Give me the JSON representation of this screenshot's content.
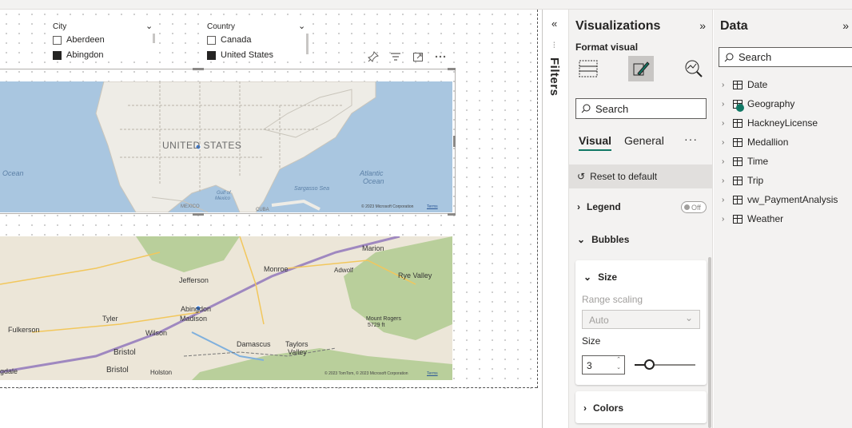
{
  "canvas": {
    "city_slicer": {
      "header": "City",
      "items": [
        {
          "label": "Aberdeen",
          "checked": false
        },
        {
          "label": "Abingdon",
          "checked": true
        }
      ]
    },
    "country_slicer": {
      "header": "Country",
      "items": [
        {
          "label": "Canada",
          "checked": false
        },
        {
          "label": "United States",
          "checked": true
        }
      ]
    },
    "map_top": {
      "country_label": "UNITED STATES",
      "ocean_left": "Ocean",
      "ocean_right_1": "Atlantic",
      "ocean_right_2": "Ocean",
      "sargasso": "Sargasso Sea",
      "gulf_1": "Gulf of",
      "gulf_2": "Mexico",
      "mexico": "MEXICO",
      "cuba": "CUBA",
      "attribution": "© 2023 Microsoft Corporation",
      "terms": "Terms"
    },
    "map_bottom": {
      "places": [
        "Marion",
        "Monroe",
        "Adwolf",
        "Rye Valley",
        "Jefferson",
        "Abingdon",
        "Madison",
        "Tyler",
        "Wilson",
        "Mount Rogers",
        "5729 ft",
        "Fulkerson",
        "Damascus",
        "Taylors",
        "Valley",
        "Bristol",
        "Bristol",
        "Holston",
        "gdale"
      ],
      "attribution": "© 2023 TomTom, © 2023 Microsoft Corporation",
      "terms": "Terms"
    }
  },
  "filters_pane": {
    "label": "Filters"
  },
  "visualizations": {
    "title": "Visualizations",
    "subtitle": "Format visual",
    "search_placeholder": "Search",
    "tabs": [
      {
        "label": "Visual",
        "active": true
      },
      {
        "label": "General",
        "active": false
      }
    ],
    "reset_label": "Reset to default",
    "legend_label": "Legend",
    "legend_toggle": "Off",
    "bubbles_label": "Bubbles",
    "size_card": {
      "title": "Size",
      "range_scaling_label": "Range scaling",
      "range_scaling_value": "Auto",
      "size_label": "Size",
      "size_value": "3"
    },
    "colors_label": "Colors",
    "accent": "#117865"
  },
  "data_pane": {
    "title": "Data",
    "search_placeholder": "Search",
    "tables": [
      "Date",
      "Geography",
      "HackneyLicense",
      "Medallion",
      "Time",
      "Trip",
      "vw_PaymentAnalysis",
      "Weather"
    ]
  }
}
